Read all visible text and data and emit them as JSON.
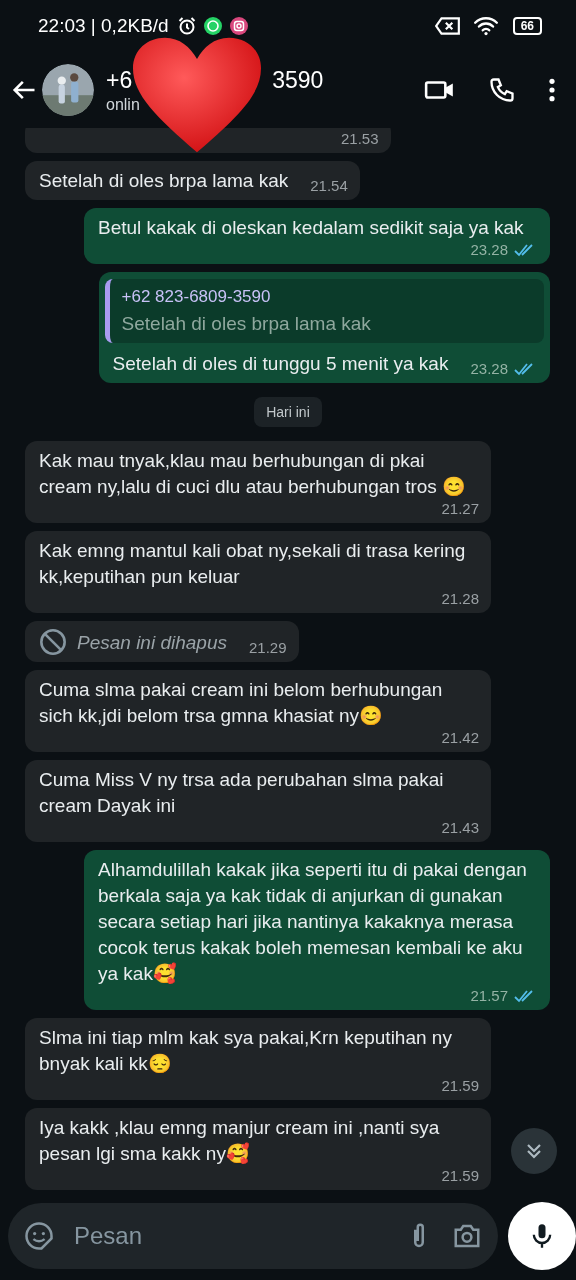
{
  "status_bar": {
    "time_and_speed": "22:03 | 0,2KB/d",
    "battery": "66"
  },
  "header": {
    "title_start": "+6",
    "title_end": "3590",
    "subtitle": "onlin"
  },
  "messages": [
    {
      "kind": "in",
      "time": "21.53"
    },
    {
      "kind": "in",
      "text": "Setelah di oles brpa lama kak",
      "time": "21.54"
    },
    {
      "kind": "out",
      "text": "Betul kakak di oleskan kedalam sedikit saja ya kak",
      "time": "23.28",
      "read": true
    },
    {
      "kind": "out",
      "quote": {
        "author": "+62 823-6809-3590",
        "text": "Setelah di oles brpa lama kak"
      },
      "text": "Setelah di oles di tunggu 5 menit ya kak",
      "time": "23.28",
      "read": true
    },
    {
      "kind": "date",
      "text": "Hari ini"
    },
    {
      "kind": "in",
      "text": "Kak mau tnyak,klau mau berhubungan di pkai cream ny,lalu di cuci dlu atau berhubungan tros 😊",
      "time": "21.27"
    },
    {
      "kind": "in",
      "text": "Kak emng mantul kali obat ny,sekali di trasa kering kk,keputihan pun keluar",
      "time": "21.28"
    },
    {
      "kind": "deleted",
      "text": "Pesan ini dihapus",
      "time": "21.29"
    },
    {
      "kind": "in",
      "text": "Cuma slma pakai cream ini belom berhubungan sich kk,jdi belom trsa gmna khasiat ny😊",
      "time": "21.42"
    },
    {
      "kind": "in",
      "text": "Cuma Miss V ny trsa ada perubahan slma pakai cream Dayak ini",
      "time": "21.43"
    },
    {
      "kind": "out",
      "text": "Alhamdulillah kakak jika seperti itu di pakai dengan berkala saja ya kak tidak di anjurkan di gunakan secara setiap hari jika nantinya kakaknya merasa cocok terus kakak boleh memesan kembali ke aku ya kak🥰",
      "time": "21.57",
      "read": true
    },
    {
      "kind": "in",
      "text": "Slma ini tiap mlm kak sya pakai,Krn keputihan ny bnyak kali kk😔",
      "time": "21.59"
    },
    {
      "kind": "in",
      "text": "Iya kakk ,klau emng manjur cream ini ,nanti sya pesan lgi sma kakk ny🥰",
      "time": "21.59"
    }
  ],
  "composer": {
    "placeholder": "Pesan"
  }
}
